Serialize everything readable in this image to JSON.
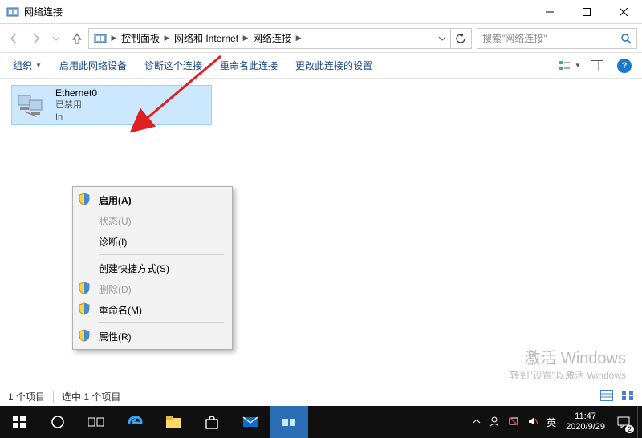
{
  "window": {
    "title": "网络连接",
    "controls": {
      "min": "—",
      "max": "☐",
      "close": "✕"
    }
  },
  "nav": {
    "breadcrumbs": [
      "控制面板",
      "网络和 Internet",
      "网络连接"
    ],
    "search_placeholder": "搜索\"网络连接\""
  },
  "cmdbar": {
    "organize": "组织",
    "items": [
      "启用此网络设备",
      "诊断这个连接",
      "重命名此连接",
      "更改此连接的设置"
    ]
  },
  "adapter": {
    "name": "Ethernet0",
    "status": "已禁用",
    "driver": "In"
  },
  "context_menu": {
    "items": [
      {
        "label": "启用(A)",
        "shield": true,
        "disabled": false,
        "selected": true
      },
      {
        "label": "状态(U)",
        "shield": false,
        "disabled": true
      },
      {
        "label": "诊断(I)",
        "shield": false,
        "disabled": false
      },
      {
        "sep": true
      },
      {
        "label": "创建快捷方式(S)",
        "shield": false,
        "disabled": false
      },
      {
        "label": "删除(D)",
        "shield": true,
        "disabled": true
      },
      {
        "label": "重命名(M)",
        "shield": true,
        "disabled": false
      },
      {
        "sep": true
      },
      {
        "label": "属性(R)",
        "shield": true,
        "disabled": false
      }
    ]
  },
  "statusbar": {
    "items": "1 个项目",
    "selected": "选中 1 个项目"
  },
  "watermark": {
    "line1": "激活 Windows",
    "line2": "转到\"设置\"以激活 Windows"
  },
  "taskbar": {
    "ime": "英",
    "clock_time": "11:47",
    "clock_date": "2020/9/29",
    "notif_count": "2"
  }
}
